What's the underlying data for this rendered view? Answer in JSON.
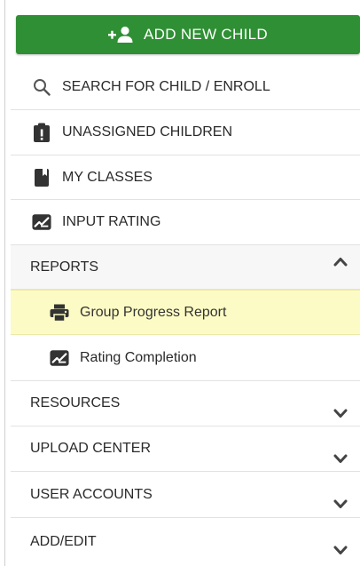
{
  "header": {
    "add_button_label": "ADD NEW CHILD"
  },
  "menu": {
    "search": "SEARCH FOR CHILD / ENROLL",
    "unassigned": "UNASSIGNED CHILDREN",
    "my_classes": "MY CLASSES",
    "input_rating": "INPUT RATING",
    "reports": {
      "label": "REPORTS",
      "expanded": true,
      "items": [
        {
          "label": "Group Progress Report",
          "icon": "printer-icon",
          "selected": true
        },
        {
          "label": "Rating Completion",
          "icon": "rating-edit-icon",
          "selected": false
        }
      ]
    },
    "resources": "RESOURCES",
    "upload_center": "UPLOAD CENTER",
    "user_accounts": "USER ACCOUNTS",
    "add_edit": "ADD/EDIT"
  },
  "colors": {
    "accent_green": "#2f8f34",
    "selected_bg": "#fdfbc5",
    "icon_gray": "#555555",
    "icon_dark": "#333333"
  }
}
